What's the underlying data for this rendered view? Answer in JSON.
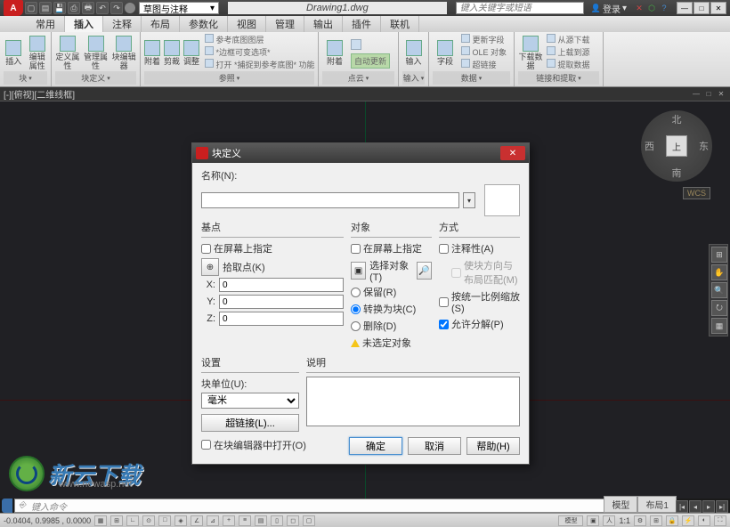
{
  "filename": "Drawing1.dwg",
  "workspace": "草图与注释",
  "search_placeholder": "键入关键字或短语",
  "login": "登录",
  "tabs": [
    "常用",
    "插入",
    "注释",
    "布局",
    "参数化",
    "视图",
    "管理",
    "输出",
    "插件",
    "联机"
  ],
  "active_tab": 1,
  "ribbon": {
    "g1": {
      "label": "块",
      "btns": [
        "插入",
        "编辑属性"
      ]
    },
    "g2": {
      "label": "块定义",
      "btns": [
        "定义属性",
        "管理属性",
        "块编辑器"
      ]
    },
    "g3": {
      "btns": [
        "附着",
        "剪裁",
        "调整"
      ]
    },
    "g4": {
      "label": "参照",
      "lines": [
        "参考底图图层",
        "*边框可变选项*",
        "打开 *捕捉到参考底图* 功能"
      ]
    },
    "g5": {
      "label": "点云",
      "btn": "附着",
      "autoupdate": "自动更新"
    },
    "g6": {
      "label": "输入",
      "btn": "输入"
    },
    "g7": {
      "label": "数据",
      "btn": "字段",
      "lines": [
        "更新字段",
        "OLE 对象",
        "超链接"
      ]
    },
    "g8": {
      "label": "链接和提取",
      "btn": "下载数据",
      "lines": [
        "从源下载",
        "上载到源",
        "提取数据"
      ]
    }
  },
  "draw_tab": "[-][俯视][二维线框]",
  "viewcube": {
    "face": "上",
    "n": "北",
    "s": "南",
    "e": "东",
    "w": "西",
    "wcs": "WCS"
  },
  "dialog": {
    "title": "块定义",
    "name_label": "名称(N):",
    "name_value": "",
    "basepoint": {
      "title": "基点",
      "onscreen": "在屏幕上指定",
      "pick": "拾取点(K)",
      "x": "X:",
      "y": "Y:",
      "z": "Z:",
      "xv": "0",
      "yv": "0",
      "zv": "0"
    },
    "objects": {
      "title": "对象",
      "onscreen": "在屏幕上指定",
      "select": "选择对象(T)",
      "retain": "保留(R)",
      "convert": "转换为块(C)",
      "delete": "删除(D)",
      "none": "未选定对象"
    },
    "behavior": {
      "title": "方式",
      "annotative": "注释性(A)",
      "match": "使块方向与布局匹配(M)",
      "uniform": "按统一比例缩放(S)",
      "explode": "允许分解(P)"
    },
    "settings": {
      "title": "设置",
      "unit_label": "块单位(U):",
      "unit": "毫米",
      "hyperlink": "超链接(L)..."
    },
    "desc": {
      "title": "说明"
    },
    "openeditor": "在块编辑器中打开(O)",
    "ok": "确定",
    "cancel": "取消",
    "help": "帮助(H)"
  },
  "watermark": {
    "text": "新云下载",
    "sub": "www.newasp.net"
  },
  "cmd_placeholder": "键入命令",
  "layout_tabs": [
    "模型",
    "布局1"
  ],
  "status": {
    "coords": "-0.0404,   0.9985 , 0.0000",
    "scale": "1:1"
  }
}
